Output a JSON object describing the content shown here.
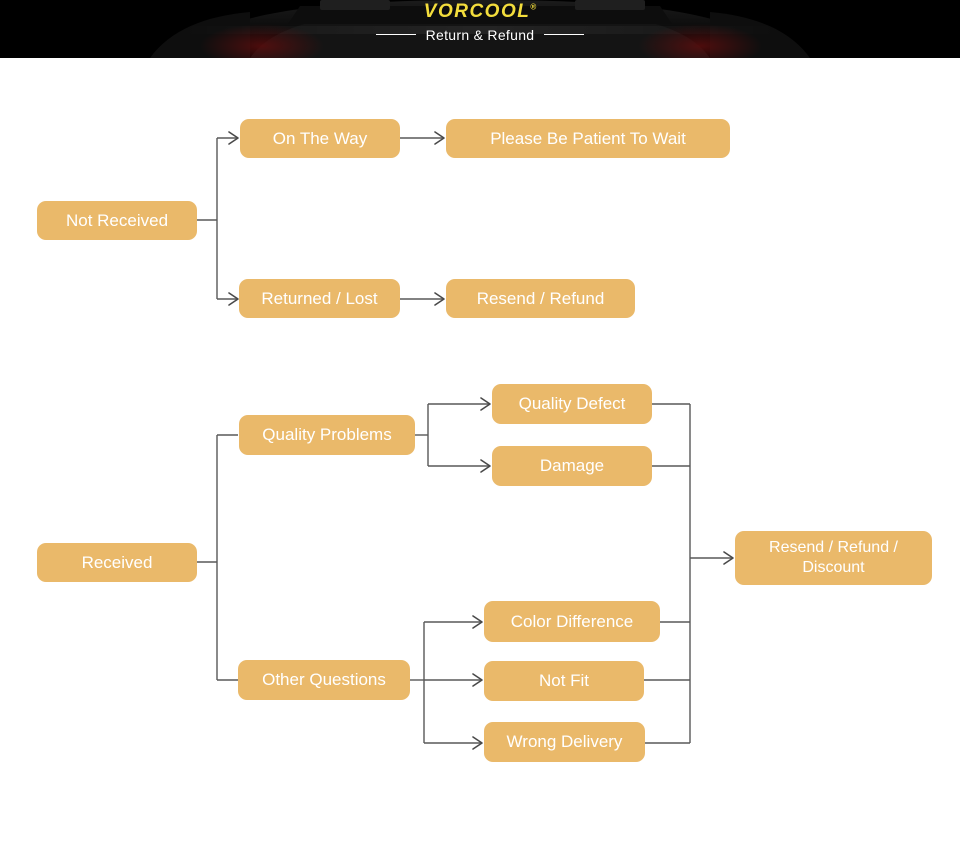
{
  "banner": {
    "brand": "VORCOOL",
    "brand_mark": "®",
    "subtitle": "Return & Refund",
    "background_color": "#000000",
    "brand_color": "#f3dd3c",
    "subtitle_color": "#ffffff"
  },
  "theme": {
    "node_fill": "#eab96a",
    "node_text": "#ffffff",
    "connector_color": "#595959",
    "page_background": "#ffffff"
  },
  "diagram": {
    "type": "flowchart",
    "flows": [
      {
        "id": "not-received",
        "root": "Not Received",
        "branches": [
          {
            "step": "On The Way",
            "outcome": "Please Be Patient To Wait"
          },
          {
            "step": "Returned / Lost",
            "outcome": "Resend / Refund"
          }
        ]
      },
      {
        "id": "received",
        "root": "Received",
        "branches": [
          {
            "step": "Quality Problems",
            "reasons": [
              "Quality Defect",
              "Damage"
            ]
          },
          {
            "step": "Other Questions",
            "reasons": [
              "Color Difference",
              "Not Fit",
              "Wrong Delivery"
            ]
          }
        ],
        "outcome": "Resend / Refund /\nDiscount"
      }
    ]
  },
  "nodes": {
    "not_received": "Not Received",
    "on_the_way": "On The Way",
    "please_be_patient": "Please Be Patient To Wait",
    "returned_lost": "Returned / Lost",
    "resend_refund": "Resend / Refund",
    "received": "Received",
    "quality_problems": "Quality Problems",
    "quality_defect": "Quality Defect",
    "damage": "Damage",
    "other_questions": "Other Questions",
    "color_difference": "Color Difference",
    "not_fit": "Not Fit",
    "wrong_delivery": "Wrong Delivery",
    "resend_refund_discount": "Resend / Refund /\nDiscount"
  }
}
